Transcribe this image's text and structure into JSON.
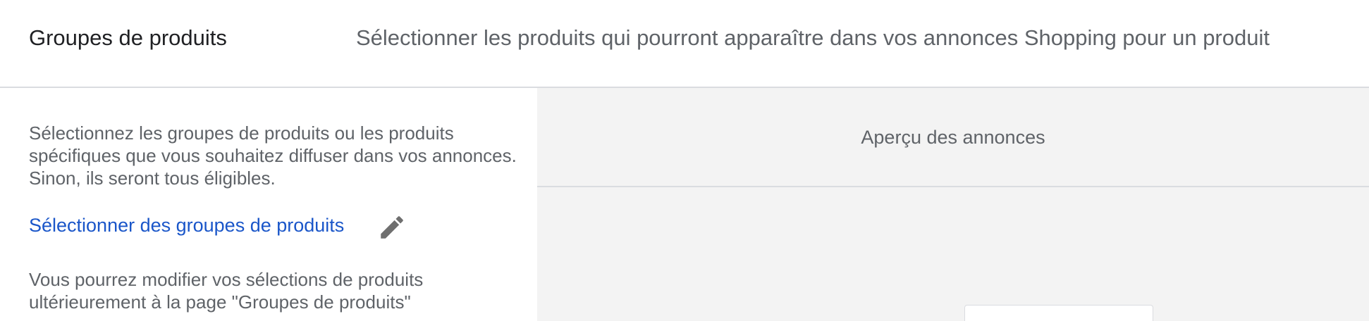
{
  "header": {
    "title": "Groupes de produits",
    "description": "Sélectionner les produits qui pourront apparaître dans vos annonces Shopping pour un produit"
  },
  "left_panel": {
    "intro": "Sélectionnez les groupes de produits ou les produits spécifiques que vous souhaitez diffuser dans vos annonces. Sinon, ils seront tous éligibles.",
    "select_link": "Sélectionner des groupes de produits",
    "edit_icon": "pencil-icon",
    "note": "Vous pourrez modifier vos sélections de produits ultérieurement à la page \"Groupes de produits\""
  },
  "preview": {
    "title": "Aperçu des annonces"
  },
  "colors": {
    "link": "#1a56c9",
    "panel_bg": "#f3f3f3",
    "divider": "#dadce0",
    "text_secondary": "#5f6368",
    "text_primary": "#202124"
  }
}
